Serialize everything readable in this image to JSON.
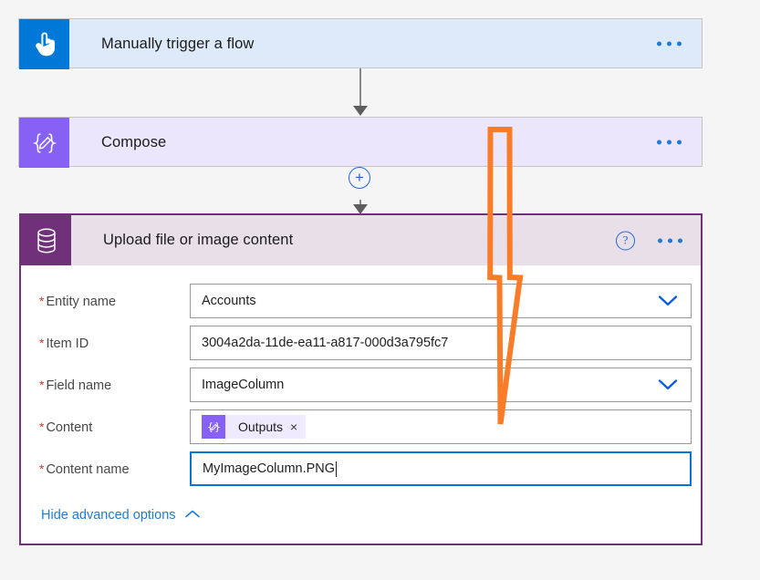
{
  "flow": {
    "steps": [
      {
        "id": "trigger",
        "title": "Manually trigger a flow",
        "icon": "tap-hand-icon",
        "accent": "#0078d7",
        "body": "#ddeaf9",
        "menu": "more-commands"
      },
      {
        "id": "compose",
        "title": "Compose",
        "icon": "compose-braces-icon",
        "accent": "#8661f4",
        "body": "#ebe6fb",
        "menu": "more-commands"
      },
      {
        "id": "upload",
        "title": "Upload file or image content",
        "icon": "dataverse-database-icon",
        "accent": "#70307a",
        "body": "#e9dfe9",
        "menu": "more-commands",
        "help": "?"
      }
    ],
    "add_step_label": "+"
  },
  "form": {
    "fields": [
      {
        "label": "Entity name",
        "required": "*",
        "value": "Accounts",
        "control": "dropdown",
        "name": "entity-name"
      },
      {
        "label": "Item ID",
        "required": "*",
        "value": "3004a2da-11de-ea11-a817-000d3a795fc7",
        "control": "text",
        "name": "item-id"
      },
      {
        "label": "Field name",
        "required": "*",
        "value": "ImageColumn",
        "control": "dropdown",
        "name": "field-name"
      },
      {
        "label": "Content",
        "required": "*",
        "value": "",
        "control": "token",
        "name": "content"
      },
      {
        "label": "Content name",
        "required": "*",
        "value": "MyImageColumn.PNG",
        "control": "text-focused",
        "name": "content-name"
      }
    ],
    "content_token": {
      "label": "Outputs",
      "remove": "×",
      "icon": "compose-braces-icon"
    },
    "advanced_options": {
      "label": "Hide advanced options",
      "icon": "chevron-up-icon"
    }
  },
  "annotation": {
    "type": "hand-drawn-arrow",
    "color": "#f97c28",
    "direction": "down"
  }
}
